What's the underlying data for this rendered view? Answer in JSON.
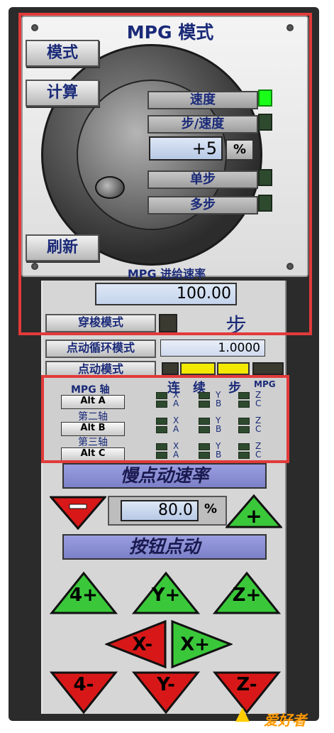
{
  "panel_title": "MPG 模式",
  "side_buttons": {
    "mode": "模式",
    "calc": "计算",
    "refresh": "刷新"
  },
  "mode_list": [
    {
      "label": "速度",
      "led_on": true
    },
    {
      "label": "步/速度",
      "led_on": false
    },
    {
      "label": "单步",
      "led_on": false
    },
    {
      "label": "多步",
      "led_on": false
    }
  ],
  "step_value": "+5",
  "percent_label": "%",
  "feed": {
    "label": "MPG 进给速率",
    "value": "100.00"
  },
  "shuttle": {
    "button": "穿梭模式",
    "word": "步"
  },
  "jog_cycle": {
    "button": "点动循环模式",
    "value": "1.0000"
  },
  "jog_mode": {
    "button": "点动模式"
  },
  "axis": {
    "head": "MPG 轴",
    "col_heads": [
      "连",
      "续",
      "步",
      "MPG"
    ],
    "rows": [
      {
        "label": "",
        "button": "Alt A",
        "axes": [
          "X",
          "A",
          "Y",
          "B",
          "Z",
          "C"
        ]
      },
      {
        "label": "第二轴",
        "button": "Alt B",
        "axes": [
          "X",
          "A",
          "Y",
          "B",
          "Z",
          "C"
        ]
      },
      {
        "label": "第三轴",
        "button": "Alt C",
        "axes": [
          "X",
          "A",
          "Y",
          "B",
          "Z",
          "C"
        ]
      }
    ]
  },
  "slow_jog_banner": "慢点动速率",
  "jog_rate": {
    "value": "80.0",
    "unit": "%",
    "minus": "-",
    "plus": "+"
  },
  "button_jog_banner": "按钮点动",
  "jog_buttons": {
    "a_plus": "4+",
    "y_plus": "Y+",
    "z_plus": "Z+",
    "x_minus": "X-",
    "x_plus": "X+",
    "a_minus": "4-",
    "y_minus": "Y-",
    "z_minus": "Z-"
  },
  "logo": "爱好者",
  "colors": {
    "accent_green": "#1aff1a",
    "label_blue": "#1a2a78",
    "highlight_red": "#e23a3a"
  }
}
